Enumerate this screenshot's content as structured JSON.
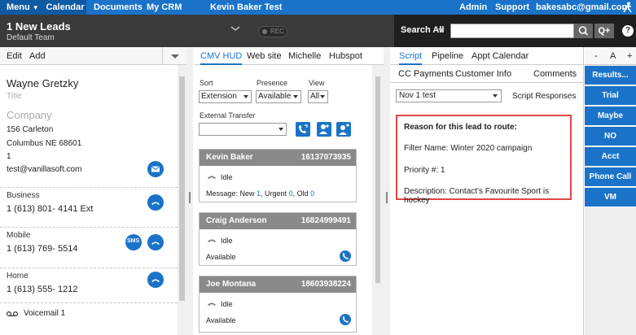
{
  "topnav": {
    "menu": "Menu",
    "calendar": "Calendar",
    "documents": "Documents",
    "my_crm": "My CRM",
    "user_title": "Kevin Baker Test",
    "admin": "Admin",
    "support": "Support",
    "email": "bakesabc@gmail.com"
  },
  "header": {
    "leads_count": "1 New Leads",
    "team": "Default Team",
    "rec": "REC",
    "search_scope": "Search All",
    "add_icon": "Q+",
    "help": "?"
  },
  "contact": {
    "toolbar": {
      "edit": "Edit",
      "add": "Add"
    },
    "name": "Wayne Gretzky",
    "title_placeholder": "Title",
    "company_placeholder": "Company",
    "address1": "156 Carleton",
    "address2": "Columbus  NE  68601",
    "address3": "1",
    "email": "test@vanillasoft.com",
    "business_label": "Business",
    "business_number": "1 (613) 801- 4141   Ext",
    "mobile_label": "Mobile",
    "mobile_number": "1 (613) 769- 5514",
    "sms": "SMS",
    "home_label": "Home",
    "home_number": "1 (613) 555- 1212",
    "voicemail": "Voicemail 1"
  },
  "hud": {
    "tabs": [
      "CMV HUD",
      "Web site",
      "Michelle",
      "Hubspot"
    ],
    "sort_label": "Sort",
    "sort_value": "Extension",
    "presence_label": "Presence",
    "presence_value": "Available",
    "view_label": "View",
    "view_value": "All",
    "external_transfer_label": "External Transfer",
    "cards": [
      {
        "name": "Kevin Baker",
        "ext": "16137073935",
        "status": "Idle",
        "msg_prefix": "Message: New ",
        "new": "1",
        "urgent_prefix": ", Urgent ",
        "urgent": "0",
        "old_prefix": ", Old ",
        "old": "0"
      },
      {
        "name": "Craig Anderson",
        "ext": "16824999491",
        "status": "Idle",
        "availability": "Available"
      },
      {
        "name": "Joe Montana",
        "ext": "18603938224",
        "status": "Idle",
        "availability": "Available"
      }
    ]
  },
  "script": {
    "tabs": [
      "Script",
      "Pipeline",
      "Appt Calendar"
    ],
    "subtabs": [
      "CC Payments",
      "Customer Info",
      "Comments"
    ],
    "selected_script": "Nov 1 test",
    "script_responses": "Script Responses",
    "reason_heading": "Reason for this lead to route:",
    "filter_name": "Filter Name: Winter 2020 campaign",
    "priority": "Priority #: 1",
    "description": "Description: Contact's Favourite Sport is hockey"
  },
  "far": {
    "minus": "-",
    "a": "A",
    "plus": "+",
    "buttons": [
      "Results...",
      "Trial",
      "Maybe",
      "NO",
      "Acct",
      "Phone Call",
      "VM"
    ]
  },
  "colors": {
    "brand_blue": "#1a73c8",
    "header_dark": "#3a3a3a",
    "alert_red": "#e04646"
  }
}
